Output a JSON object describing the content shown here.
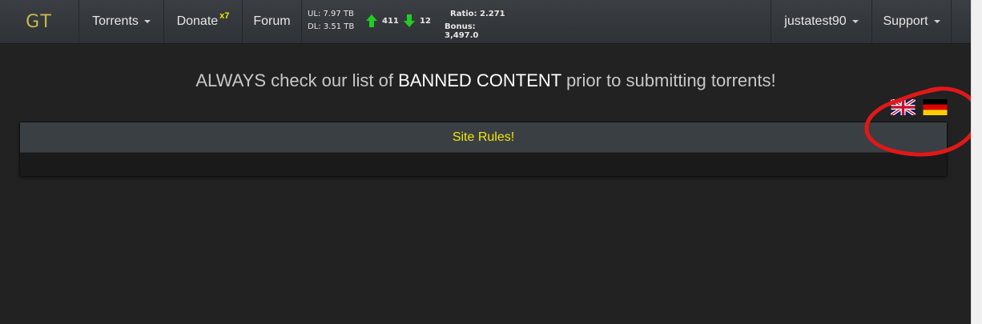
{
  "navbar": {
    "logo": "GT",
    "torrents_label": "Torrents",
    "donate_label": "Donate",
    "donate_multiplier": "x7",
    "forum_label": "Forum",
    "user_label": "justatest90",
    "support_label": "Support"
  },
  "stats": {
    "upload": "UL: 7.97 TB",
    "download": "DL: 3.51 TB",
    "seeding_count": "411",
    "leeching_count": "12",
    "ratio": "Ratio: 2.271",
    "bonus": "Bonus: 3,497.0"
  },
  "banner": {
    "prefix": "ALWAYS check our list of",
    "emphasis": "BANNED CONTENT",
    "suffix": "prior to submitting torrents!"
  },
  "flags": [
    "uk-flag",
    "germany-flag"
  ],
  "panel": {
    "heading": "Site Rules!"
  },
  "colors": {
    "background": "#222222",
    "navbar": "#34383c",
    "accent_yellow": "#f0e600",
    "annotation_red": "#e01818",
    "arrow_green": "#22cc22"
  }
}
